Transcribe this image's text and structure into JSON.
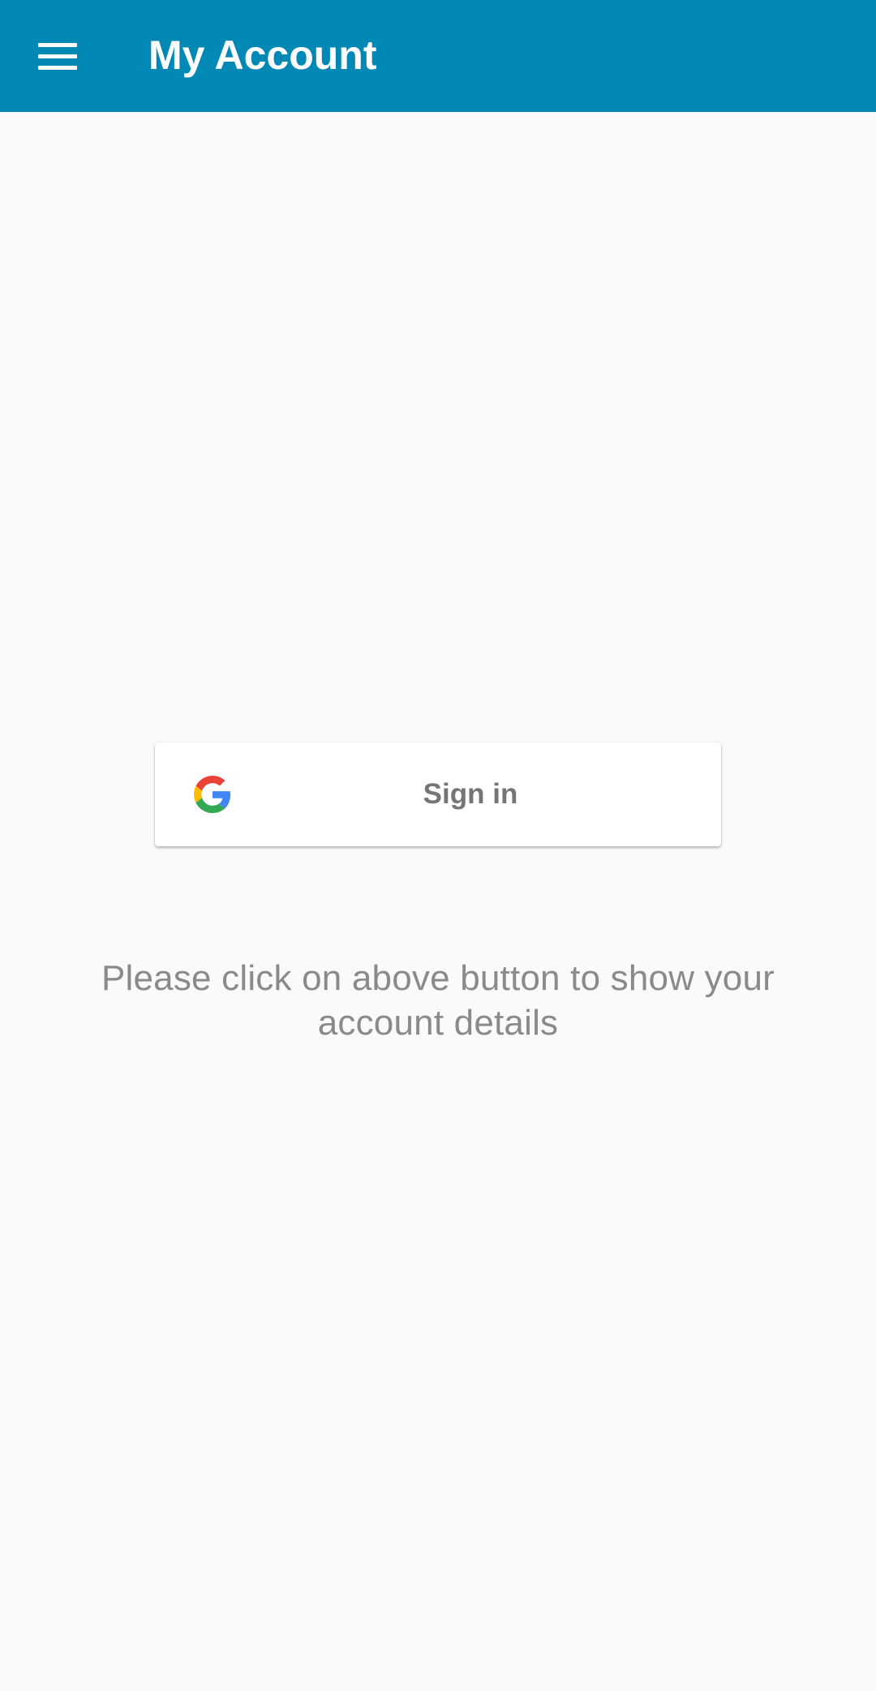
{
  "toolbar": {
    "menu_icon": "hamburger-menu-icon",
    "title": "My Account",
    "background_color": "#0288b5"
  },
  "signin": {
    "icon": "google-g-icon",
    "label": "Sign in"
  },
  "hint": {
    "text": "Please click on above button to show your account details"
  }
}
